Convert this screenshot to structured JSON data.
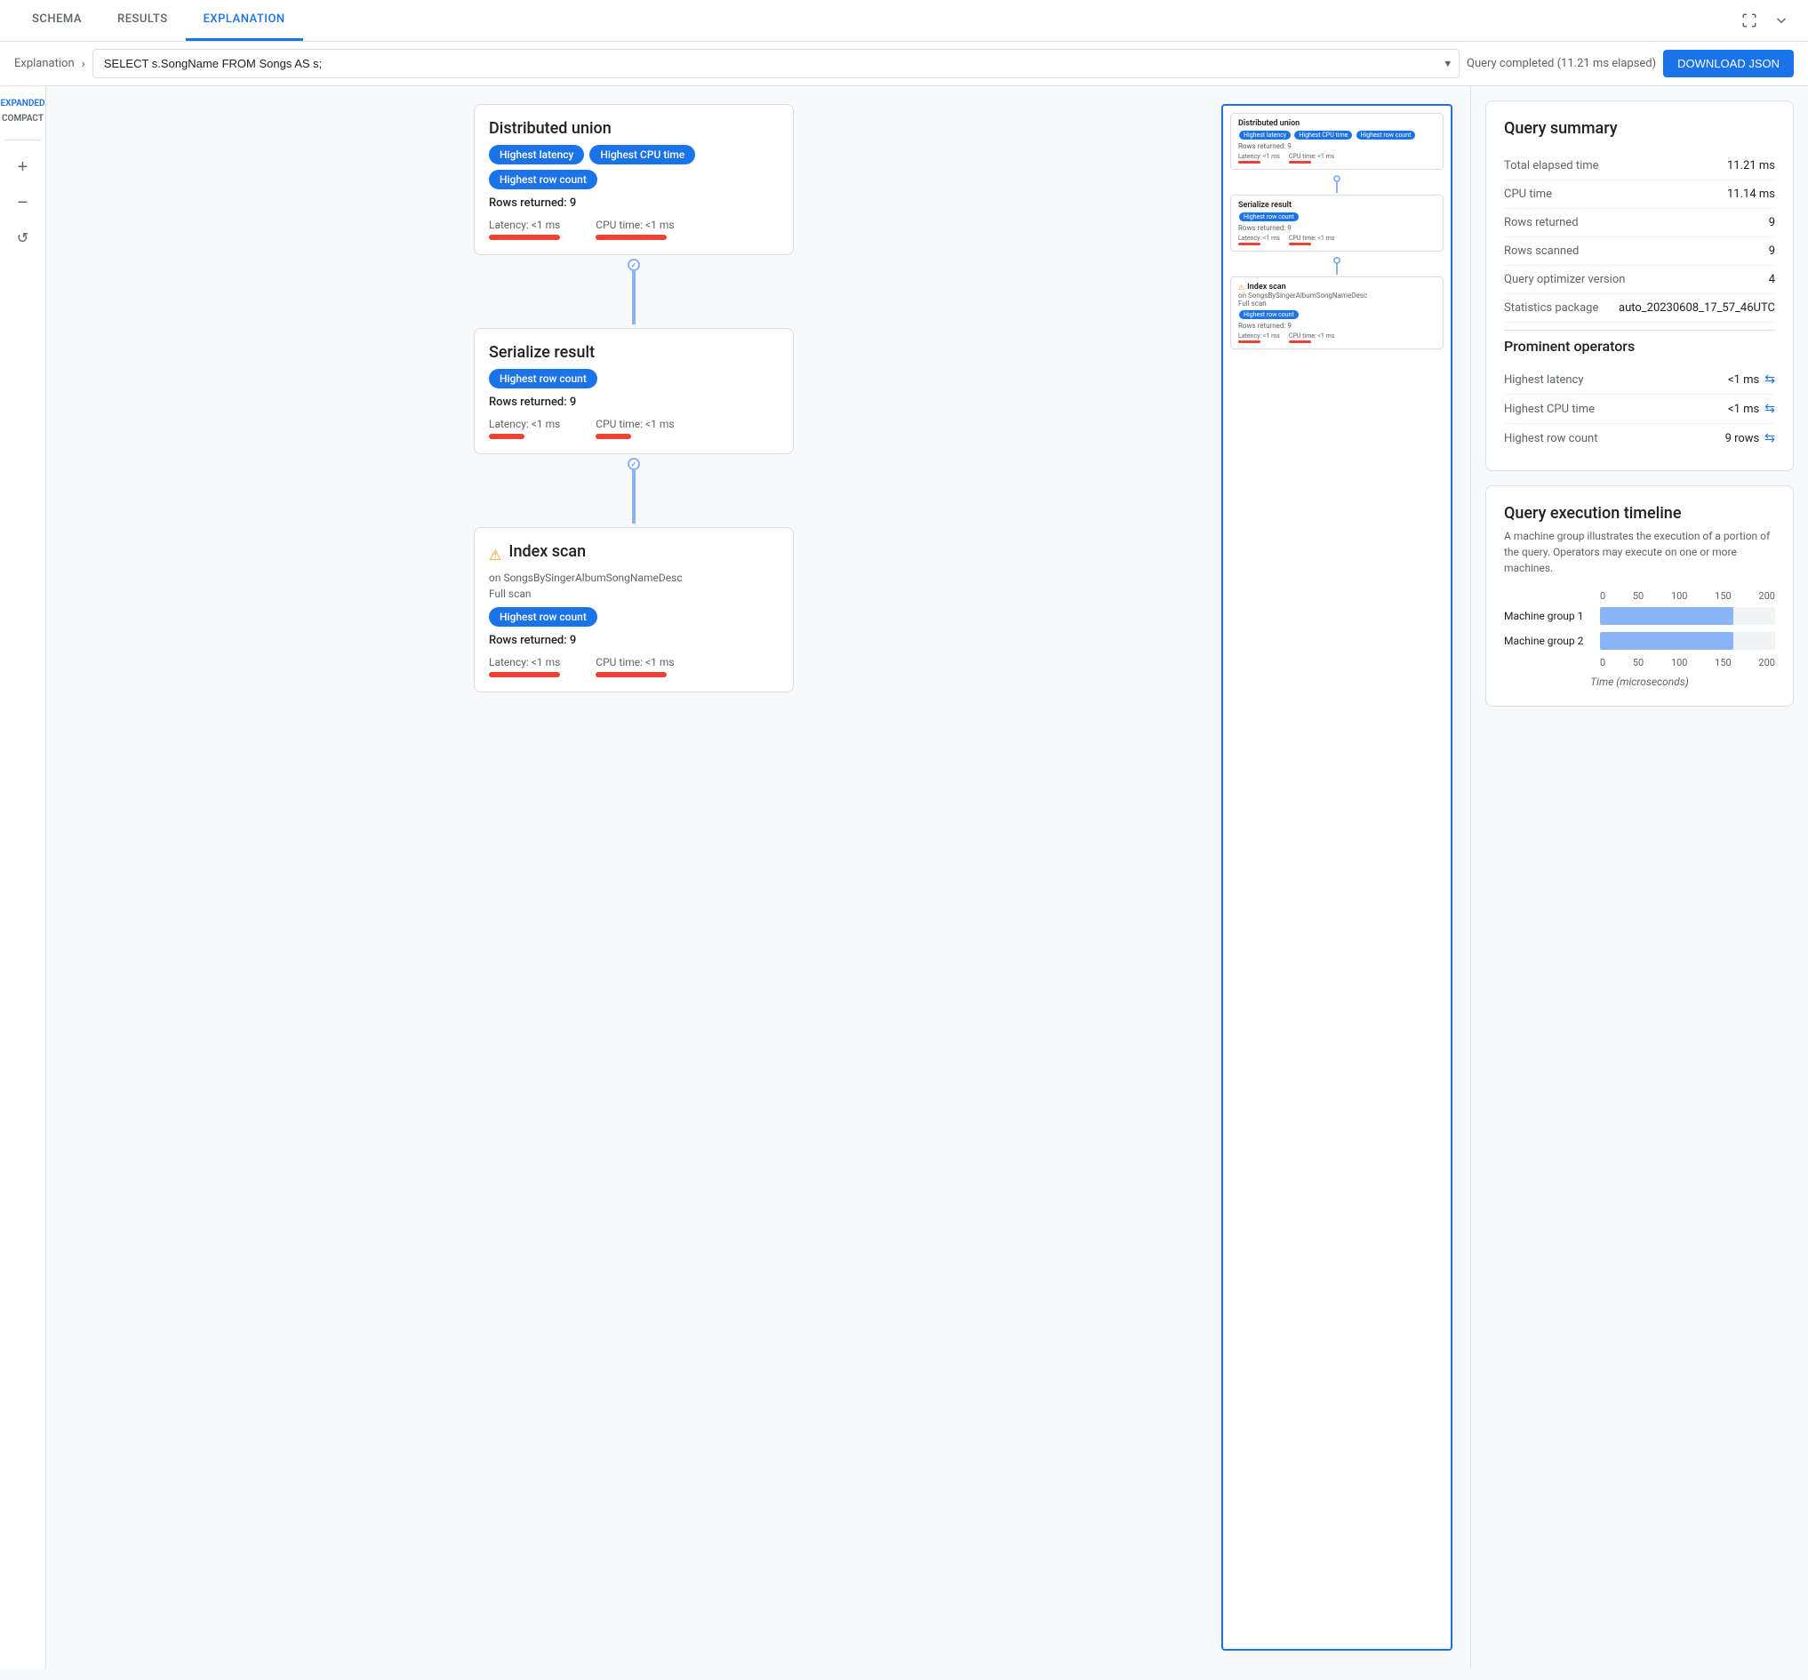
{
  "tabs": [
    {
      "label": "SCHEMA",
      "active": false
    },
    {
      "label": "RESULTS",
      "active": false
    },
    {
      "label": "EXPLANATION",
      "active": true
    }
  ],
  "query_bar": {
    "breadcrumb": "Explanation",
    "query_text": "SELECT s.SongName FROM Songs AS s;",
    "status": "Query completed (11.21 ms elapsed)",
    "download_btn": "DOWNLOAD JSON"
  },
  "view_modes": {
    "expanded": "EXPANDED",
    "compact": "COMPACT"
  },
  "toolbar": {
    "zoom_in": "+",
    "zoom_out": "−",
    "reset": "↺"
  },
  "nodes": [
    {
      "id": "distributed-union",
      "title": "Distributed union",
      "badges": [
        "Highest latency",
        "Highest CPU time",
        "Highest row count"
      ],
      "rows_returned": "Rows returned: 9",
      "latency": "Latency: <1 ms",
      "cpu_time": "CPU time: <1 ms"
    },
    {
      "id": "serialize-result",
      "title": "Serialize result",
      "badges": [
        "Highest row count"
      ],
      "rows_returned": "Rows returned: 9",
      "latency": "Latency: <1 ms",
      "cpu_time": "CPU time: <1 ms"
    },
    {
      "id": "index-scan",
      "title": "Index scan",
      "subtitle_on": "on SongsBySingerAlbumSongNameDesc",
      "subtitle_full": "Full scan",
      "badges": [
        "Highest row count"
      ],
      "rows_returned": "Rows returned: 9",
      "latency": "Latency: <1 ms",
      "cpu_time": "CPU time: <1 ms"
    }
  ],
  "query_summary": {
    "title": "Query summary",
    "rows": [
      {
        "key": "Total elapsed time",
        "value": "11.21 ms"
      },
      {
        "key": "CPU time",
        "value": "11.14 ms"
      },
      {
        "key": "Rows returned",
        "value": "9"
      },
      {
        "key": "Rows scanned",
        "value": "9"
      },
      {
        "key": "Query optimizer version",
        "value": "4"
      },
      {
        "key": "Statistics package",
        "value": "auto_20230608_17_57_46UTC"
      }
    ]
  },
  "prominent_operators": {
    "title": "Prominent operators",
    "rows": [
      {
        "key": "Highest latency",
        "value": "<1 ms"
      },
      {
        "key": "Highest CPU time",
        "value": "<1 ms"
      },
      {
        "key": "Highest row count",
        "value": "9 rows"
      }
    ]
  },
  "timeline": {
    "title": "Query execution timeline",
    "description": "A machine group illustrates the execution of a portion of the query.\nOperators may execute on one or more machines.",
    "axis_labels": [
      "0",
      "50",
      "100",
      "150",
      "200"
    ],
    "bars": [
      {
        "label": "Machine group 1",
        "width_pct": 76
      },
      {
        "label": "Machine group 2",
        "width_pct": 76
      }
    ],
    "x_axis_label": "Time (microseconds)",
    "axis_bottom": [
      "0",
      "50",
      "100",
      "150",
      "200"
    ]
  },
  "mini_preview": {
    "nodes": [
      {
        "title": "Distributed union",
        "badges": [
          "Highest latency",
          "Highest CPU time",
          "Highest row count"
        ],
        "rows": "Rows returned: 9",
        "latency": "Latency: <1 ms",
        "cpu_time": "CPU time: <1 ms"
      },
      {
        "title": "Serialize result",
        "badges": [
          "Highest row count"
        ],
        "rows": "Rows returned: 9",
        "latency": "Latency: <1 ms",
        "cpu_time": "CPU time: <1 ms"
      },
      {
        "title": "Index scan",
        "subtitle": "on SongsBySingerAlbumSongNameDesc",
        "subtitle2": "Full scan",
        "badges": [
          "Highest row count"
        ],
        "rows": "Rows returned: 9",
        "latency": "Latency: <1 ms",
        "cpu_time": "CPU time: <1 ms"
      }
    ]
  }
}
